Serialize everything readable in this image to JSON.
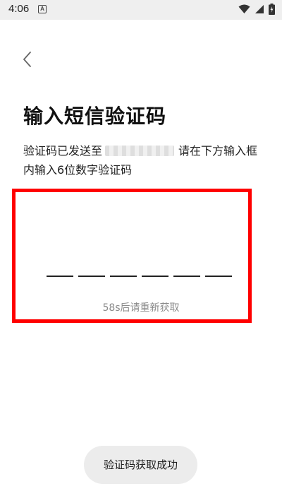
{
  "status_bar": {
    "time": "4:06",
    "notification_icon_letter": "A"
  },
  "page": {
    "title": "输入短信验证码",
    "description_prefix": "验证码已发送至",
    "description_suffix": "请在下方输入框内输入6位数字验证码"
  },
  "otp": {
    "length": 6,
    "resend_text": "58s后请重新获取"
  },
  "toast": {
    "text": "验证码获取成功"
  },
  "colors": {
    "highlight": "#ff0000",
    "resend_text": "#8a8a8a",
    "toast_bg": "#ececec"
  },
  "icons": [
    "back-arrow-icon",
    "wifi-icon",
    "signal-icon",
    "battery-icon"
  ]
}
